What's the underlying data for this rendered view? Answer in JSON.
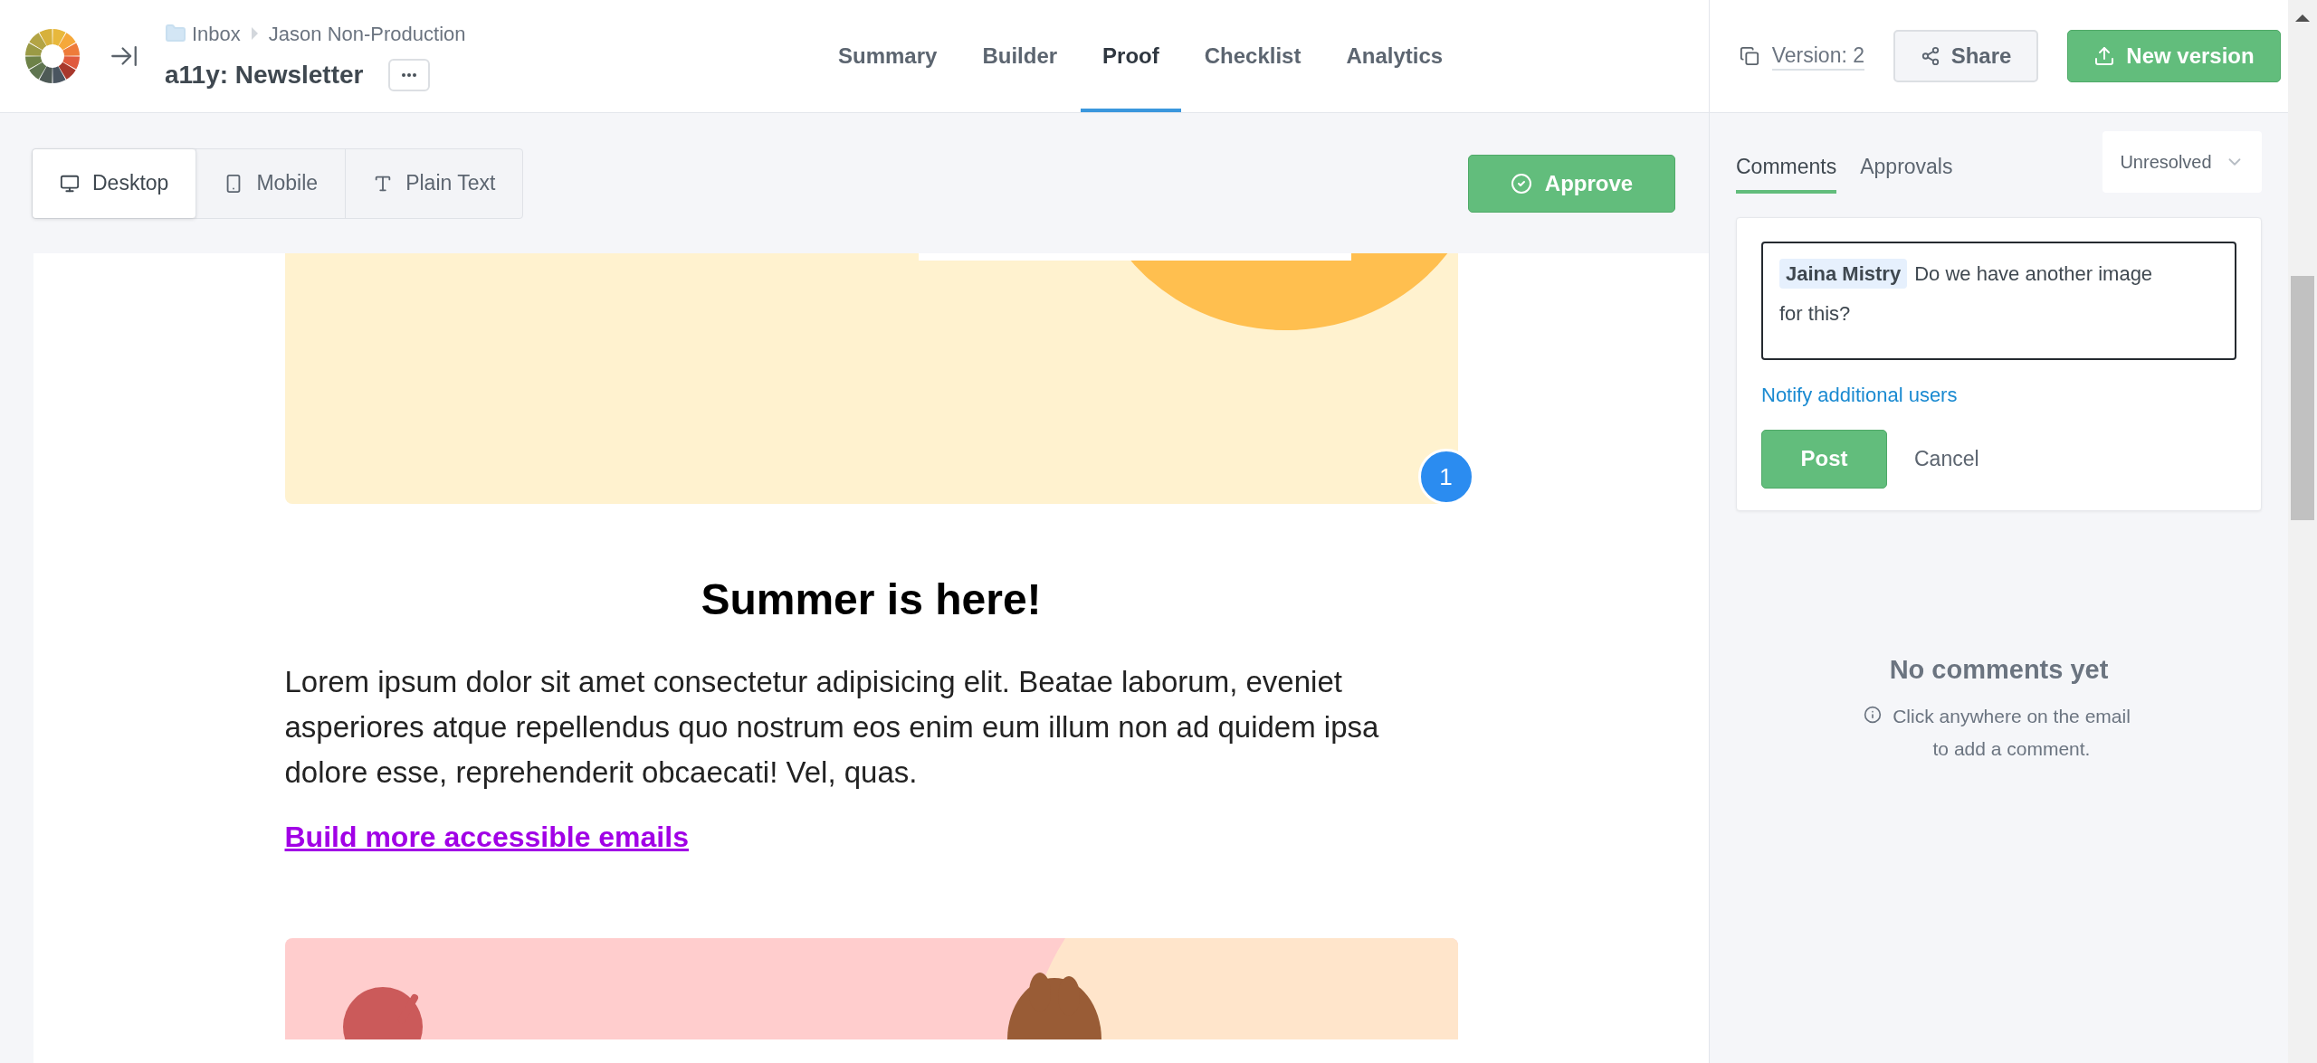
{
  "header": {
    "breadcrumb": [
      "Inbox",
      "Jason Non-Production"
    ],
    "title": "a11y: Newsletter",
    "nav_tabs": [
      {
        "label": "Summary",
        "selected": false
      },
      {
        "label": "Builder",
        "selected": false
      },
      {
        "label": "Proof",
        "selected": true
      },
      {
        "label": "Checklist",
        "selected": false
      },
      {
        "label": "Analytics",
        "selected": false
      }
    ],
    "version": "Version: 2",
    "share_button": "Share",
    "new_version_button": "New version"
  },
  "toolbar": {
    "view_tabs": [
      {
        "kind": "desktop",
        "label": "Desktop",
        "selected": true
      },
      {
        "kind": "mobile",
        "label": "Mobile",
        "selected": false
      },
      {
        "kind": "text",
        "label": "Plain Text",
        "selected": false
      }
    ],
    "approve_button": "Approve"
  },
  "email": {
    "comment_pin": "1",
    "heading": "Summer is here!",
    "body": "Lorem ipsum dolor sit amet consectetur adipisicing elit. Beatae laborum, eveniet asperiores atque repellendus quo nostrum eos enim eum illum non ad quidem ipsa dolore esse, reprehenderit obcaecati! Vel, quas.",
    "link": "Build more accessible emails"
  },
  "sidebar": {
    "tabs": [
      {
        "label": "Comments",
        "selected": true
      },
      {
        "label": "Approvals",
        "selected": false
      }
    ],
    "filter": "Unresolved",
    "comment": {
      "mention": "Jaina Mistry",
      "text": "Do we have another image for this?"
    },
    "notify_link": "Notify additional users",
    "post_button": "Post",
    "cancel_button": "Cancel",
    "empty_title": "No comments yet",
    "empty_hint": "Click anywhere on the email to add a comment."
  }
}
